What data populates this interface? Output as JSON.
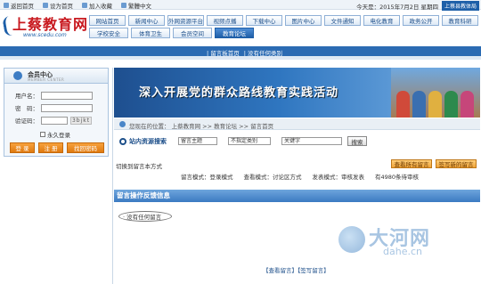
{
  "topbar": {
    "links": [
      "返回首页",
      "设为首页",
      "加入收藏",
      "繁體中文"
    ],
    "date": "今天是：2015年7月2日 星期四",
    "badge": "上蔡县教体局"
  },
  "logo": {
    "title": "上蔡教育网",
    "url": "www.scedu.com"
  },
  "nav": {
    "row1": [
      "网站首页",
      "新闻中心",
      "外网资源平台",
      "视频点播",
      "下载中心",
      "图片中心",
      "文件通知",
      "电化教育",
      "政务公开",
      "教育科研"
    ],
    "row2": [
      "学校安全",
      "体育卫生",
      "会员空间",
      "教育论坛"
    ],
    "active_row1": "视频点播",
    "active_row2": "教育论坛"
  },
  "subnav": {
    "items": [
      "| 留言板首页",
      "| 没有任何类别"
    ]
  },
  "member": {
    "title": "会员中心",
    "subtitle": "MEMBER CENTER",
    "username_label": "用户名：",
    "password_label": "密　码：",
    "captcha_label": "验证码：",
    "captcha_value": "3bjkt",
    "remember_label": "永久登录",
    "buttons": [
      "登 录",
      "注 册",
      "找回密码"
    ]
  },
  "banner": {
    "text": "深入开展党的群众路线教育实践活动"
  },
  "breadcrumb": "您现在的位置： 上蔡教育网 >> 教育论坛 >> 留言首页",
  "search": {
    "label": "站内资源搜索",
    "select1": "留言主题",
    "select2": "不指定类别",
    "keyword": "关键字",
    "button": "搜索"
  },
  "mode": {
    "switch": "切换到留言本方式",
    "items": [
      "留言模式：登录模式",
      "查看模式：讨论区方式",
      "发表模式：审核发表",
      "有4980条待审核"
    ],
    "btn_all": "查看所有留言",
    "btn_new": "签写新的留言"
  },
  "section": {
    "title": "留言操作反馈信息",
    "empty": "· 没有任何留言"
  },
  "bottom_links": "【查看留言】【签写留言】",
  "watermark": {
    "name": "大河网",
    "url": "dahe.cn"
  }
}
